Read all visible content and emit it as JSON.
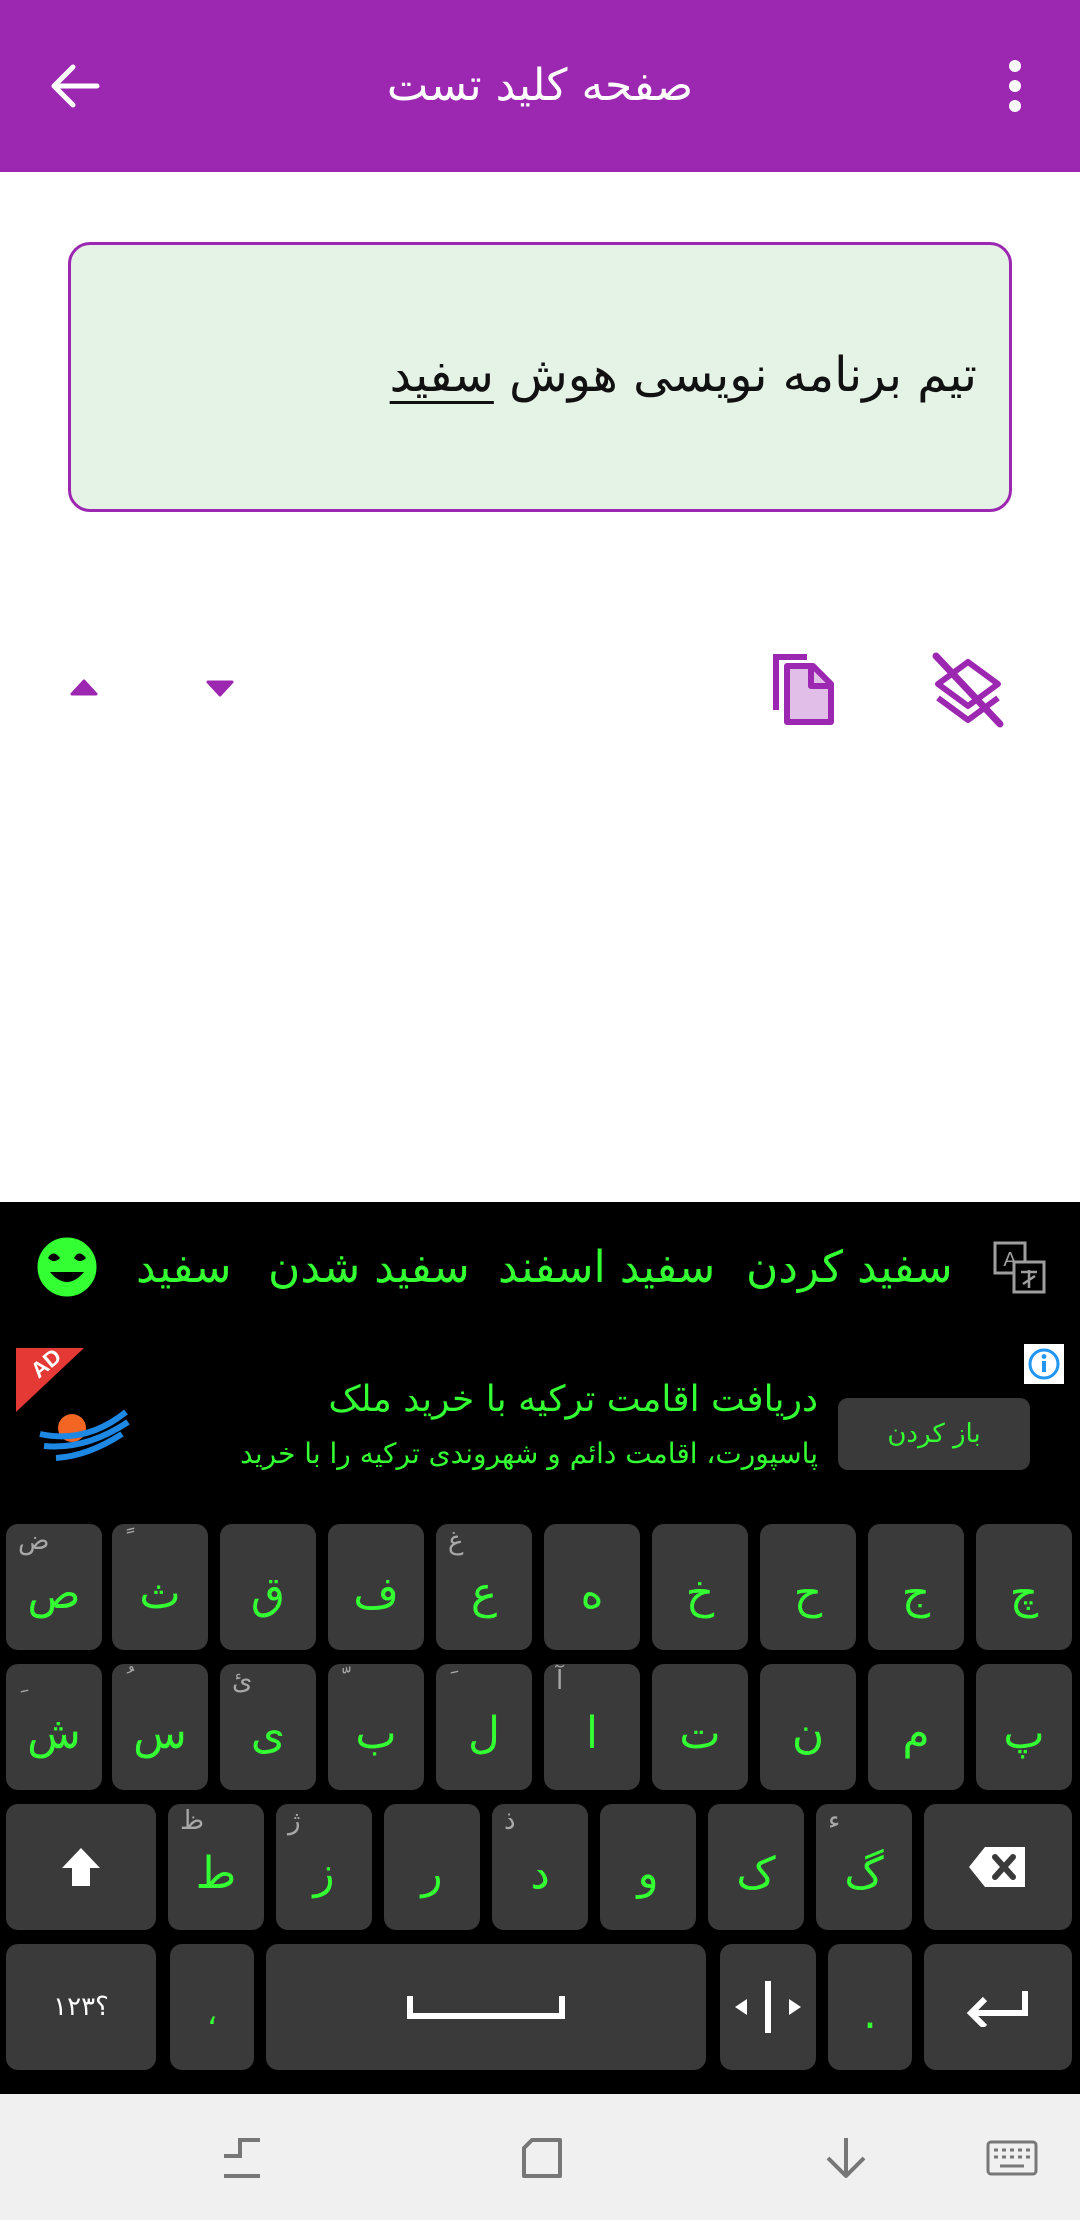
{
  "app": {
    "title": "صفحه کلید تست"
  },
  "editor": {
    "text_before": "تیم برنامه نویسی هوش ",
    "text_highlight": "سفید"
  },
  "suggestions": [
    "سفید کردن",
    "سفید اسفند",
    "سفید شدن",
    "سفید"
  ],
  "ad": {
    "badge": "AD",
    "headline": "دریافت اقامت ترکیه با خرید ملک",
    "description": "پاسپورت، اقامت دائم و شهروندی ترکیه را با خرید",
    "button": "باز کردن"
  },
  "keyboard": {
    "row1": [
      {
        "main": "چ",
        "alt": ""
      },
      {
        "main": "ج",
        "alt": ""
      },
      {
        "main": "ح",
        "alt": ""
      },
      {
        "main": "خ",
        "alt": ""
      },
      {
        "main": "ه",
        "alt": ""
      },
      {
        "main": "ع",
        "alt": "غ"
      },
      {
        "main": "ف",
        "alt": ""
      },
      {
        "main": "ق",
        "alt": ""
      },
      {
        "main": "ث",
        "alt": "ً"
      },
      {
        "main": "ص",
        "alt": "ض"
      }
    ],
    "row2": [
      {
        "main": "پ",
        "alt": ""
      },
      {
        "main": "م",
        "alt": ""
      },
      {
        "main": "ن",
        "alt": ""
      },
      {
        "main": "ت",
        "alt": ""
      },
      {
        "main": "ا",
        "alt": "آ"
      },
      {
        "main": "ل",
        "alt": "َ"
      },
      {
        "main": "ب",
        "alt": "ّ"
      },
      {
        "main": "ی",
        "alt": "ئ"
      },
      {
        "main": "س",
        "alt": "ُ"
      },
      {
        "main": "ش",
        "alt": "ِ"
      }
    ],
    "row3": [
      {
        "main": "گ",
        "alt": "ء"
      },
      {
        "main": "ک",
        "alt": ""
      },
      {
        "main": "و",
        "alt": ""
      },
      {
        "main": "د",
        "alt": "ذ"
      },
      {
        "main": "ر",
        "alt": ""
      },
      {
        "main": "ز",
        "alt": "ژ"
      },
      {
        "main": "ط",
        "alt": "ظ"
      }
    ],
    "symbols_label": "؟۱۲۳",
    "comma": "،",
    "period": "."
  },
  "colors": {
    "primary": "#9c27b0",
    "key_text": "#33ff33",
    "key_bg": "#3a3a3a",
    "keyboard_bg": "#000000",
    "editor_bg": "#e5f2e6"
  }
}
